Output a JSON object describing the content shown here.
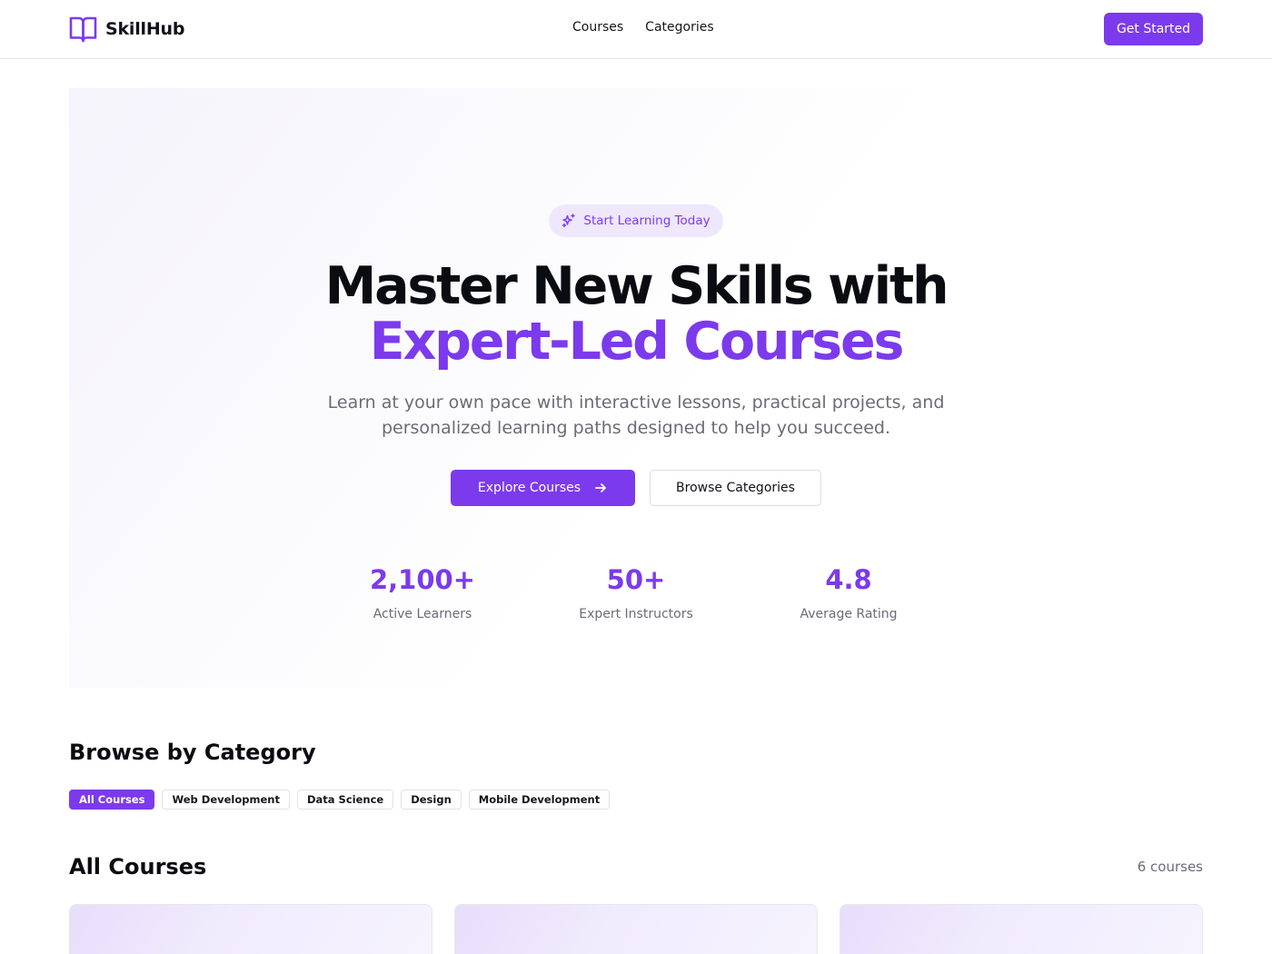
{
  "brand": {
    "name": "SkillHub",
    "logo_icon": "open-book-icon",
    "accent": "#7c3aed"
  },
  "nav": {
    "items": [
      {
        "label": "Courses"
      },
      {
        "label": "Categories"
      }
    ],
    "cta_label": "Get Started"
  },
  "hero": {
    "badge": {
      "icon": "sparkles-icon",
      "label": "Start Learning Today"
    },
    "title_line1": "Master New Skills with",
    "title_line2": "Expert-Led Courses",
    "subtitle_line1": "Learn at your own pace with interactive lessons, practical projects, and",
    "subtitle_line2": "personalized learning paths designed to help you succeed.",
    "primary_button": {
      "label": "Explore Courses",
      "icon": "arrow-right-icon"
    },
    "secondary_button": {
      "label": "Browse Categories"
    },
    "stats": [
      {
        "value": "2,100+",
        "label": "Active Learners"
      },
      {
        "value": "50+",
        "label": "Expert Instructors"
      },
      {
        "value": "4.8",
        "label": "Average Rating"
      }
    ]
  },
  "categories": {
    "title": "Browse by Category",
    "chips": [
      {
        "label": "All Courses",
        "active": true
      },
      {
        "label": "Web Development",
        "active": false
      },
      {
        "label": "Data Science",
        "active": false
      },
      {
        "label": "Design",
        "active": false
      },
      {
        "label": "Mobile Development",
        "active": false
      }
    ]
  },
  "courses": {
    "title": "All Courses",
    "count_label": "6 courses"
  }
}
